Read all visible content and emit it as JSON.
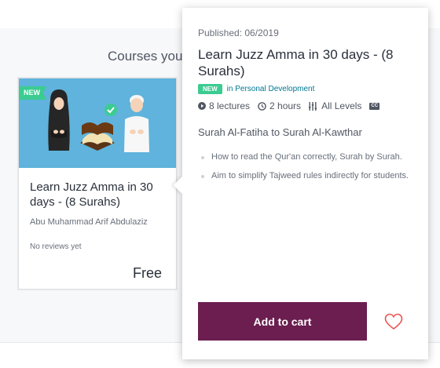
{
  "section": {
    "title": "Courses you"
  },
  "course_card": {
    "ribbon": "NEW",
    "title": "Learn Juzz Amma in 30 days - (8 Surahs)",
    "author": "Abu Muhammad Arif Abdulaziz",
    "reviews": "No reviews yet",
    "price": "Free"
  },
  "popover": {
    "published": "Published: 06/2019",
    "title": "Learn Juzz Amma in 30 days - (8 Surahs)",
    "badge": "NEW",
    "category": "in Personal Development",
    "lectures": "8 lectures",
    "duration": "2 hours",
    "level": "All Levels",
    "captions": "CC",
    "subtitle": "Surah Al-Fatiha to Surah Al-Kawthar",
    "bullets": [
      "How to read the Qur'an correctly, Surah by Surah.",
      "Aim to simplify Tajweed rules indirectly for students."
    ],
    "cart_label": "Add to cart"
  },
  "colors": {
    "brand_button": "#6b1e4f",
    "new_badge": "#3ccb91",
    "category_link": "#007791",
    "thumbnail_bg": "#5fb3dc",
    "heart": "#ec5252"
  },
  "icons": {
    "lectures": "play-circle-icon",
    "duration": "clock-icon",
    "level": "level-bars-icon",
    "wishlist": "heart-icon"
  }
}
